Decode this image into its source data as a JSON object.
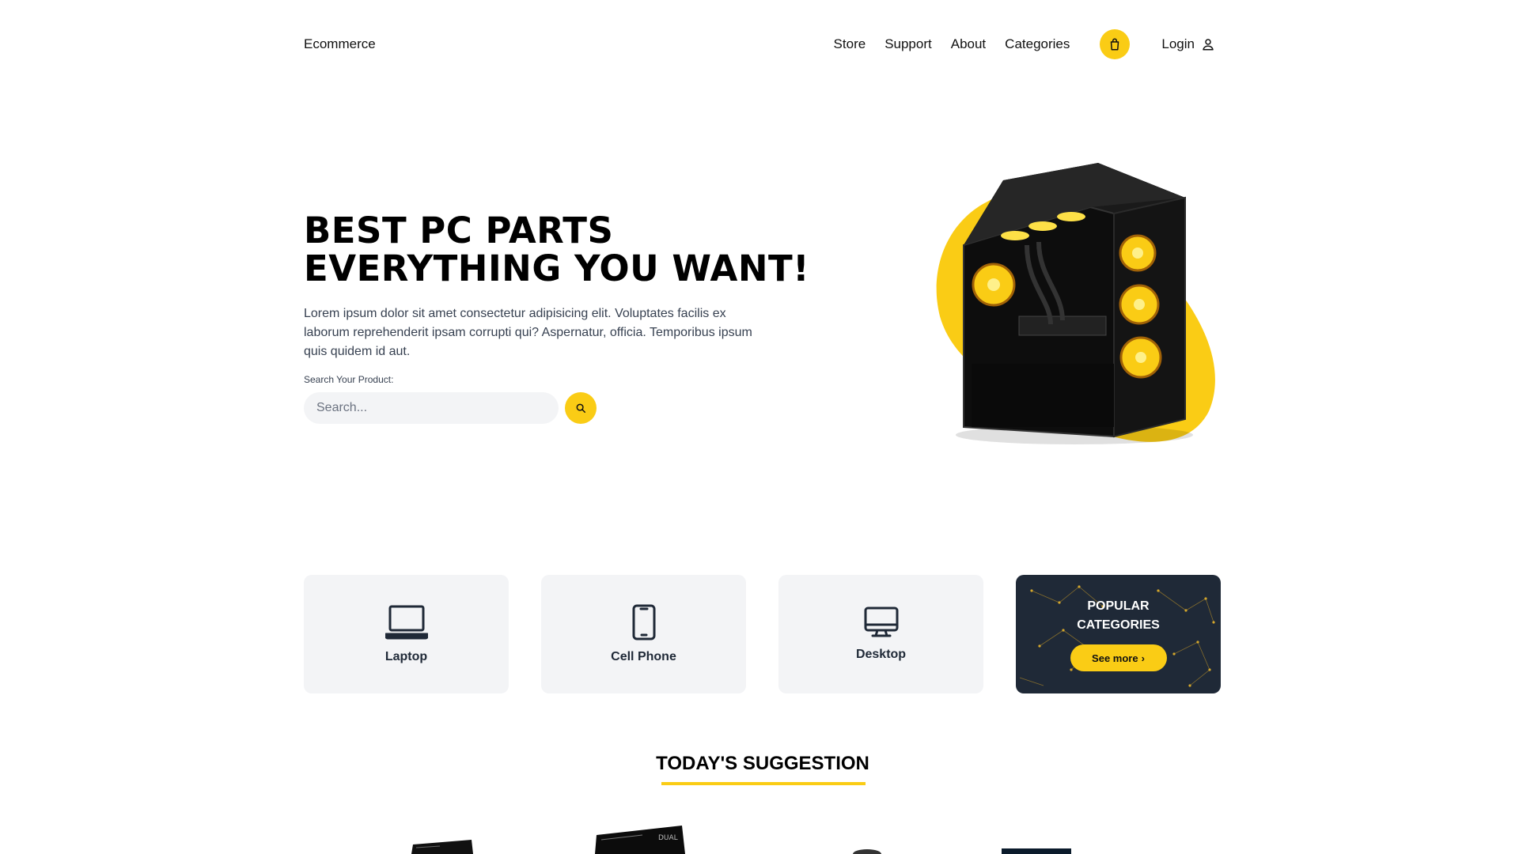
{
  "nav": {
    "brand": "Ecommerce",
    "links": [
      "Store",
      "Support",
      "About",
      "Categories"
    ],
    "login_label": "Login"
  },
  "hero": {
    "title_line1": "BEST PC PARTS",
    "title_line2": "EVERYTHING YOU WANT!",
    "description": "Lorem ipsum dolor sit amet consectetur adipisicing elit. Voluptates facilis ex laborum reprehenderit ipsam corrupti qui? Aspernatur, officia. Temporibus ipsum quis quidem id aut.",
    "search_label": "Search Your Product:",
    "search_placeholder": "Search..."
  },
  "categories": [
    {
      "label": "Laptop",
      "icon": "laptop-icon"
    },
    {
      "label": "Cell Phone",
      "icon": "cell-phone-icon"
    },
    {
      "label": "Desktop",
      "icon": "desktop-icon"
    }
  ],
  "popular": {
    "title": "POPULAR CATEGORIES",
    "button_label": "See more"
  },
  "suggestion": {
    "title": "TODAY'S SUGGESTION"
  },
  "colors": {
    "accent": "#facc15",
    "card_bg": "#f3f4f6",
    "dark_card": "#1f2937"
  }
}
